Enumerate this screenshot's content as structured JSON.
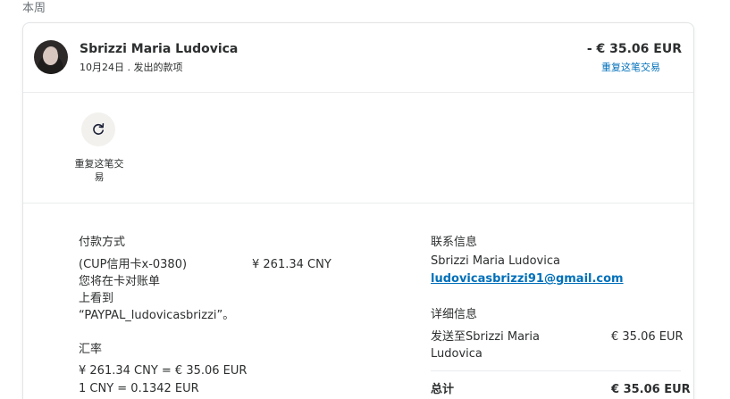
{
  "section_label": "本周",
  "transaction": {
    "name": "Sbrizzi Maria Ludovica",
    "subtitle": "10月24日 . 发出的款项",
    "amount": "- € 35.06 EUR",
    "repeat_link": "重复这笔交易"
  },
  "actions": {
    "repeat_label": "重复这笔交易",
    "icon": "refresh-icon"
  },
  "payment": {
    "heading": "付款方式",
    "method_line1": "(CUP信用卡x-0380)",
    "method_line2": "您将在卡对账单",
    "method_line3": "上看到",
    "method_line4": "“PAYPAL_ludovicasbrizzi”。",
    "method_amount": "¥ 261.34 CNY",
    "rate_heading": "汇率",
    "rate_line1": "¥ 261.34 CNY = € 35.06 EUR",
    "rate_line2": "1 CNY = 0.1342 EUR"
  },
  "contact": {
    "heading": "联系信息",
    "name": "Sbrizzi Maria Ludovica",
    "email": "ludovicasbrizzi91@gmail.com"
  },
  "detail": {
    "heading": "详细信息",
    "sent_to_line1": "发送至Sbrizzi Maria",
    "sent_to_line2": "Ludovica",
    "sent_amount": "€ 35.06 EUR",
    "total_label": "总计",
    "total_amount": "€ 35.06 EUR"
  },
  "colors": {
    "link": "#0070ba",
    "text": "#2c2e2f",
    "muted": "#6c7378"
  }
}
